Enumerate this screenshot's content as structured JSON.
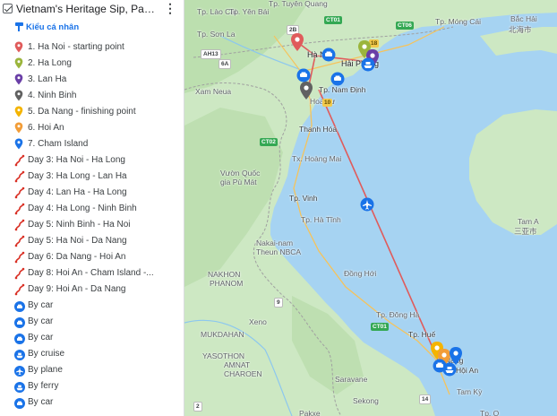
{
  "panel": {
    "title": "Vietnam's Heritage Sip, Paddle, D...",
    "style_link": "Kiểu cá nhân",
    "more_icon": "⋮",
    "items": [
      {
        "label": "1. Ha Noi - starting point",
        "kind": "pin",
        "color": "#e05b5b"
      },
      {
        "label": "2. Ha Long",
        "kind": "pin",
        "color": "#9bb53c"
      },
      {
        "label": "3. Lan Ha",
        "kind": "pin",
        "color": "#6a3fa7"
      },
      {
        "label": "4. Ninh Binh",
        "kind": "pin",
        "color": "#616161"
      },
      {
        "label": "5. Da Nang - finishing point",
        "kind": "pin",
        "color": "#f4b400"
      },
      {
        "label": "6. Hoi An",
        "kind": "pin",
        "color": "#f29d38"
      },
      {
        "label": "7. Cham Island",
        "kind": "pin",
        "color": "#1a73e8"
      },
      {
        "label": "Day 3: Ha Noi - Ha Long",
        "kind": "route",
        "color": "#d93025"
      },
      {
        "label": "Day 3: Ha Long - Lan Ha",
        "kind": "route",
        "color": "#d93025"
      },
      {
        "label": "Day 4: Lan Ha - Ha Long",
        "kind": "route",
        "color": "#d93025"
      },
      {
        "label": "Day 4: Ha Long - Ninh Binh",
        "kind": "route",
        "color": "#d93025"
      },
      {
        "label": "Day 5: Ninh Binh - Ha Noi",
        "kind": "route",
        "color": "#d93025"
      },
      {
        "label": "Day 5: Ha Noi - Da Nang",
        "kind": "route",
        "color": "#d93025"
      },
      {
        "label": "Day 6: Da Nang - Hoi An",
        "kind": "route",
        "color": "#d93025"
      },
      {
        "label": "Day 8: Hoi An - Cham Island -...",
        "kind": "route",
        "color": "#d93025"
      },
      {
        "label": "Day 9: Hoi An - Da Nang",
        "kind": "route",
        "color": "#d93025"
      },
      {
        "label": "By car",
        "kind": "car",
        "color": "#1a73e8"
      },
      {
        "label": "By car",
        "kind": "car",
        "color": "#1a73e8"
      },
      {
        "label": "By car",
        "kind": "car",
        "color": "#1a73e8"
      },
      {
        "label": "By cruise",
        "kind": "ship",
        "color": "#1a73e8"
      },
      {
        "label": "By plane",
        "kind": "plane",
        "color": "#1a73e8"
      },
      {
        "label": "By ferry",
        "kind": "ship",
        "color": "#1a73e8"
      },
      {
        "label": "By car",
        "kind": "car",
        "color": "#1a73e8"
      }
    ]
  },
  "map": {
    "labels": {
      "tp_lao_cai": "Tp. Lào Cai",
      "tp_yen_bai": "Tp. Yên Bái",
      "tp_tuyen_quang": "Tp. Tuyên Quang",
      "tp_son_la": "Tp. Sơn La",
      "tp_mong_cai": "Tp. Móng Cái",
      "bac_hai": "Bắc Hải",
      "bac_hai_cn": "北海市",
      "ha_noi": "Hà Nội",
      "hai_phong": "Hải Phòng",
      "xam_neua": "Xam Neua",
      "hoa_lu": "Hoa Lư",
      "nam_dinh": "Tp. Nam Định",
      "thanh_hoa": "Thanh Hóa",
      "tx_hoang_mai": "Tx. Hoàng Mai",
      "vuon_quoc_gia_1": "Vườn Quốc",
      "vuon_quoc_gia_2": "gia Pù Mát",
      "tp_vinh": "Tp. Vinh",
      "tp_ha_tinh": "Tp. Hà Tĩnh",
      "tam_a": "Tam A",
      "tam_a_cn": "三亚市",
      "nakai_1": "Nakai-nam",
      "nakai_2": "Theun NBCA",
      "dong_hoi": "Đồng Hới",
      "nakhon_1": "NAKHON",
      "nakhon_2": "PHANOM",
      "xeno": "Xeno",
      "tp_dong_ha": "Tp. Đông Hà",
      "mukdahan": "MUKDAHAN",
      "tp_hue": "Tp. Huế",
      "yasothon": "YASOTHON",
      "amnat_1": "AMNAT",
      "amnat_2": "CHAROEN",
      "hoi_an": "Hội An",
      "nang": "Nang",
      "saravane": "Saravane",
      "tam_ky": "Tam Kỳ",
      "sekong": "Sekong",
      "pakxe": "Pakxe",
      "tp_q": "Tp. Q"
    },
    "shields": {
      "ct01_n": "CT01",
      "ct06": "CT06",
      "ah13": "AH13",
      "s6a": "6A",
      "s2b": "2B",
      "s18": "18",
      "ct02": "CT02",
      "s10": "10",
      "ct01_s": "CT01",
      "s9": "9",
      "s14": "14",
      "s2": "2"
    },
    "colors": {
      "sea": "#a6d3f2",
      "land": "#cde8c3",
      "land_dark": "#b3d9a4",
      "route": "#e05b5b"
    }
  }
}
